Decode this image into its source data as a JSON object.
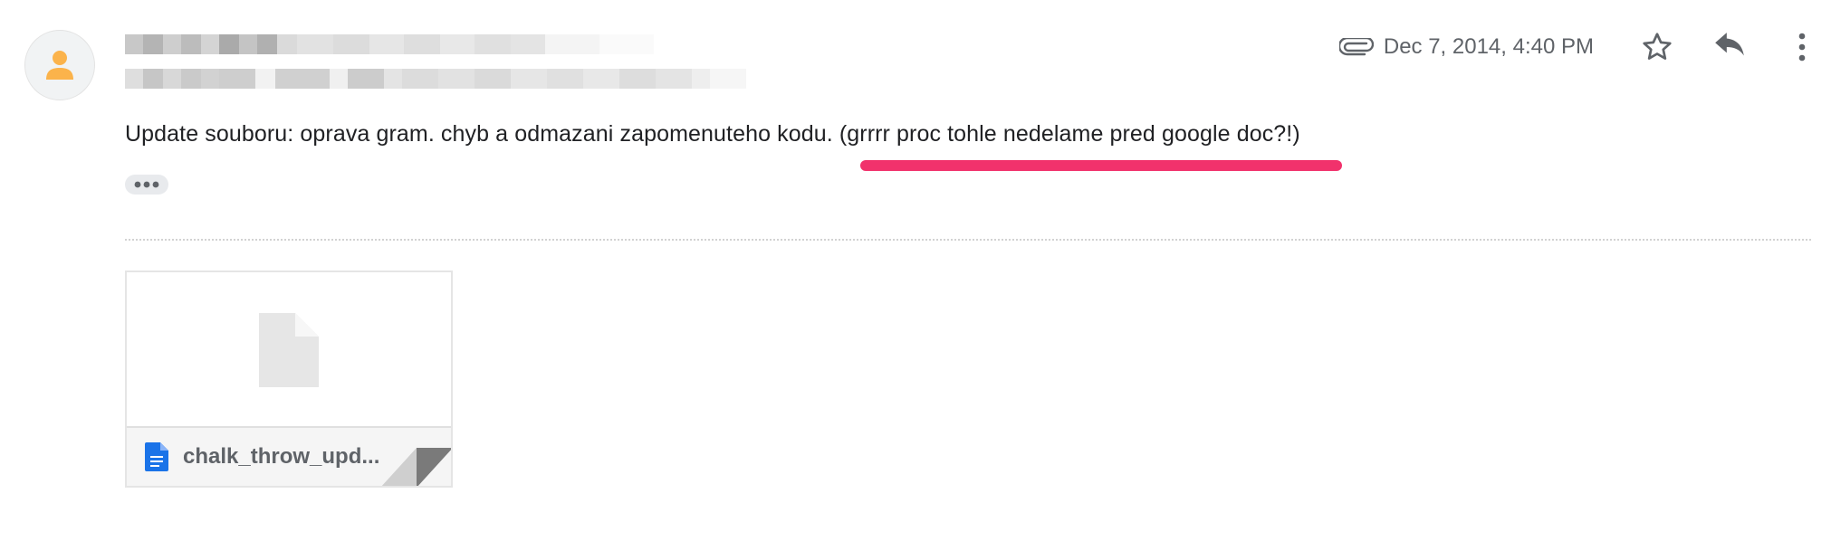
{
  "header": {
    "avatar_icon": "person-icon",
    "attachment_icon": "paperclip-icon",
    "date": "Dec 7, 2014, 4:40 PM",
    "actions": [
      {
        "icon": "star-icon"
      },
      {
        "icon": "reply-icon"
      },
      {
        "icon": "more-vert-icon"
      }
    ]
  },
  "message": {
    "body": "Update souboru: oprava gram. chyb a odmazani zapomenuteho kodu. (grrrr proc tohle nedelame pred google doc?!)",
    "highlight_color": "#f1326c",
    "show_trimmed_icon": "ellipsis-icon"
  },
  "attachment": {
    "file_name": "chalk_throw_upd...",
    "file_icon": "document-icon",
    "file_icon_color": "#1a73e8",
    "preview_icon": "generic-file-icon"
  }
}
